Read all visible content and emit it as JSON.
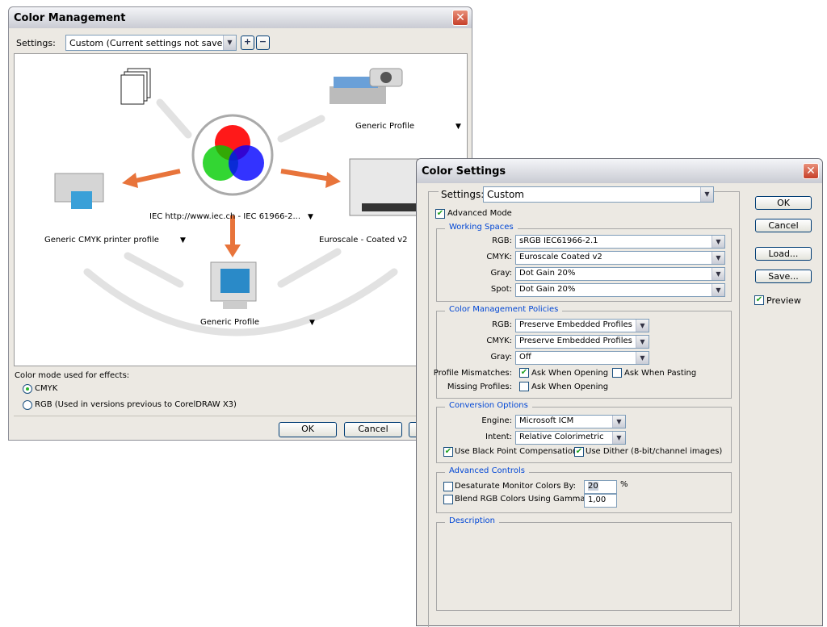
{
  "color_management": {
    "title": "Color Management",
    "settings_label": "Settings:",
    "settings_value": "Custom (Current settings not saved)",
    "diagram": {
      "scanner_camera_profile": "Generic Profile",
      "rgb_profile": "IEC http://www.iec.ch - IEC 61966-2...",
      "printer_profile": "Generic CMYK printer profile",
      "press_profile": "Euroscale - Coated v2",
      "monitor_profile": "Generic Profile",
      "arrow_color": "#e8743b"
    },
    "effects_label": "Color mode used for effects:",
    "effects_options": [
      {
        "label": "CMYK",
        "selected": true
      },
      {
        "label": "RGB (Used in versions previous to CorelDRAW X3)",
        "selected": false
      }
    ],
    "ok": "OK",
    "cancel": "Cancel"
  },
  "color_settings": {
    "title": "Color Settings",
    "settings_label": "Settings:",
    "settings_value": "Custom",
    "advanced_mode": {
      "label": "Advanced Mode",
      "checked": true
    },
    "working_spaces": {
      "title": "Working Spaces",
      "rows": [
        {
          "label": "RGB:",
          "value": "sRGB IEC61966-2.1"
        },
        {
          "label": "CMYK:",
          "value": "Euroscale Coated v2"
        },
        {
          "label": "Gray:",
          "value": "Dot Gain 20%"
        },
        {
          "label": "Spot:",
          "value": "Dot Gain 20%"
        }
      ]
    },
    "policies": {
      "title": "Color Management Policies",
      "rows": [
        {
          "label": "RGB:",
          "value": "Preserve Embedded Profiles"
        },
        {
          "label": "CMYK:",
          "value": "Preserve Embedded Profiles"
        },
        {
          "label": "Gray:",
          "value": "Off"
        }
      ],
      "mismatches_label": "Profile Mismatches:",
      "ask_opening": {
        "label": "Ask When Opening",
        "checked": true
      },
      "ask_pasting": {
        "label": "Ask When Pasting",
        "checked": false
      },
      "missing_label": "Missing Profiles:",
      "missing_ask_opening": {
        "label": "Ask When Opening",
        "checked": false
      }
    },
    "conversion": {
      "title": "Conversion Options",
      "engine_label": "Engine:",
      "engine": "Microsoft ICM",
      "intent_label": "Intent:",
      "intent": "Relative Colorimetric",
      "black_point": {
        "label": "Use Black Point Compensation",
        "checked": true
      },
      "dither": {
        "label": "Use Dither (8-bit/channel images)",
        "checked": true
      }
    },
    "advanced": {
      "title": "Advanced Controls",
      "desaturate": {
        "label": "Desaturate Monitor Colors By:",
        "checked": false,
        "value": "20",
        "unit": "%"
      },
      "blend": {
        "label": "Blend RGB Colors Using Gamma:",
        "checked": false,
        "value": "1,00"
      }
    },
    "description": {
      "title": "Description"
    },
    "buttons": {
      "ok": "OK",
      "cancel": "Cancel",
      "load": "Load...",
      "save": "Save..."
    },
    "preview": {
      "label": "Preview",
      "checked": true
    }
  }
}
